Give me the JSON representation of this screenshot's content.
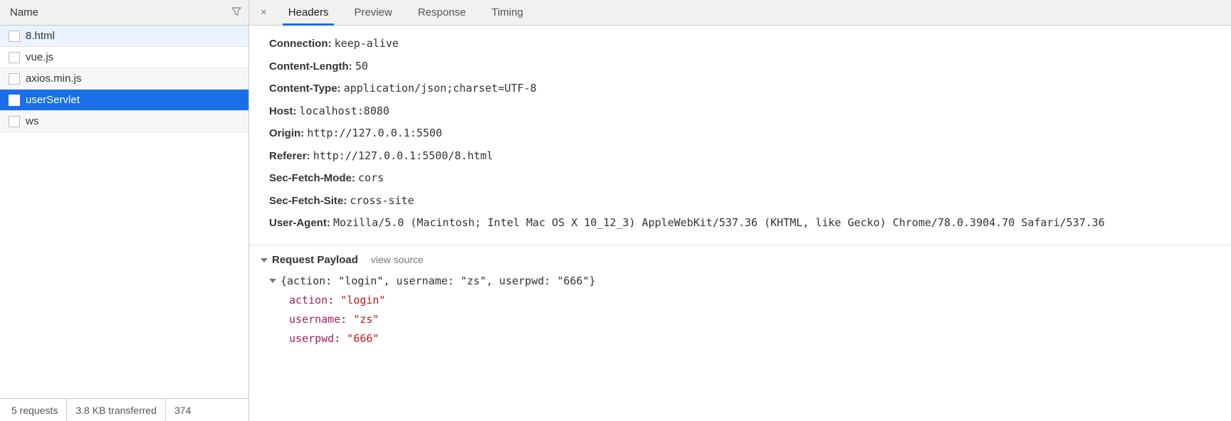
{
  "left": {
    "header_title": "Name",
    "requests": [
      {
        "name": "8.html",
        "state": "highlighted"
      },
      {
        "name": "vue.js",
        "state": ""
      },
      {
        "name": "axios.min.js",
        "state": "odd"
      },
      {
        "name": "userServlet",
        "state": "selected"
      },
      {
        "name": "ws",
        "state": "odd"
      }
    ],
    "footer": {
      "requests": "5 requests",
      "transferred": "3.8 KB transferred",
      "extra": "374"
    }
  },
  "tabs": {
    "close": "×",
    "items": [
      "Headers",
      "Preview",
      "Response",
      "Timing"
    ],
    "active_index": 0
  },
  "headers_section": {
    "lines": [
      {
        "key": "Connection:",
        "val": "keep-alive"
      },
      {
        "key": "Content-Length:",
        "val": "50"
      },
      {
        "key": "Content-Type:",
        "val": "application/json;charset=UTF-8"
      },
      {
        "key": "Host:",
        "val": "localhost:8080"
      },
      {
        "key": "Origin:",
        "val": "http://127.0.0.1:5500"
      },
      {
        "key": "Referer:",
        "val": "http://127.0.0.1:5500/8.html"
      },
      {
        "key": "Sec-Fetch-Mode:",
        "val": "cors"
      },
      {
        "key": "Sec-Fetch-Site:",
        "val": "cross-site"
      },
      {
        "key": "User-Agent:",
        "val": "Mozilla/5.0 (Macintosh; Intel Mac OS X 10_12_3) AppleWebKit/537.36 (KHTML, like Gecko) Chrome/78.0.3904.70 Safari/537.36"
      }
    ]
  },
  "payload": {
    "section_title": "Request Payload",
    "view_source": "view source",
    "summary": "{action: \"login\", username: \"zs\", userpwd: \"666\"}",
    "props": [
      {
        "key": "action",
        "val": "\"login\""
      },
      {
        "key": "username",
        "val": "\"zs\""
      },
      {
        "key": "userpwd",
        "val": "\"666\""
      }
    ]
  }
}
